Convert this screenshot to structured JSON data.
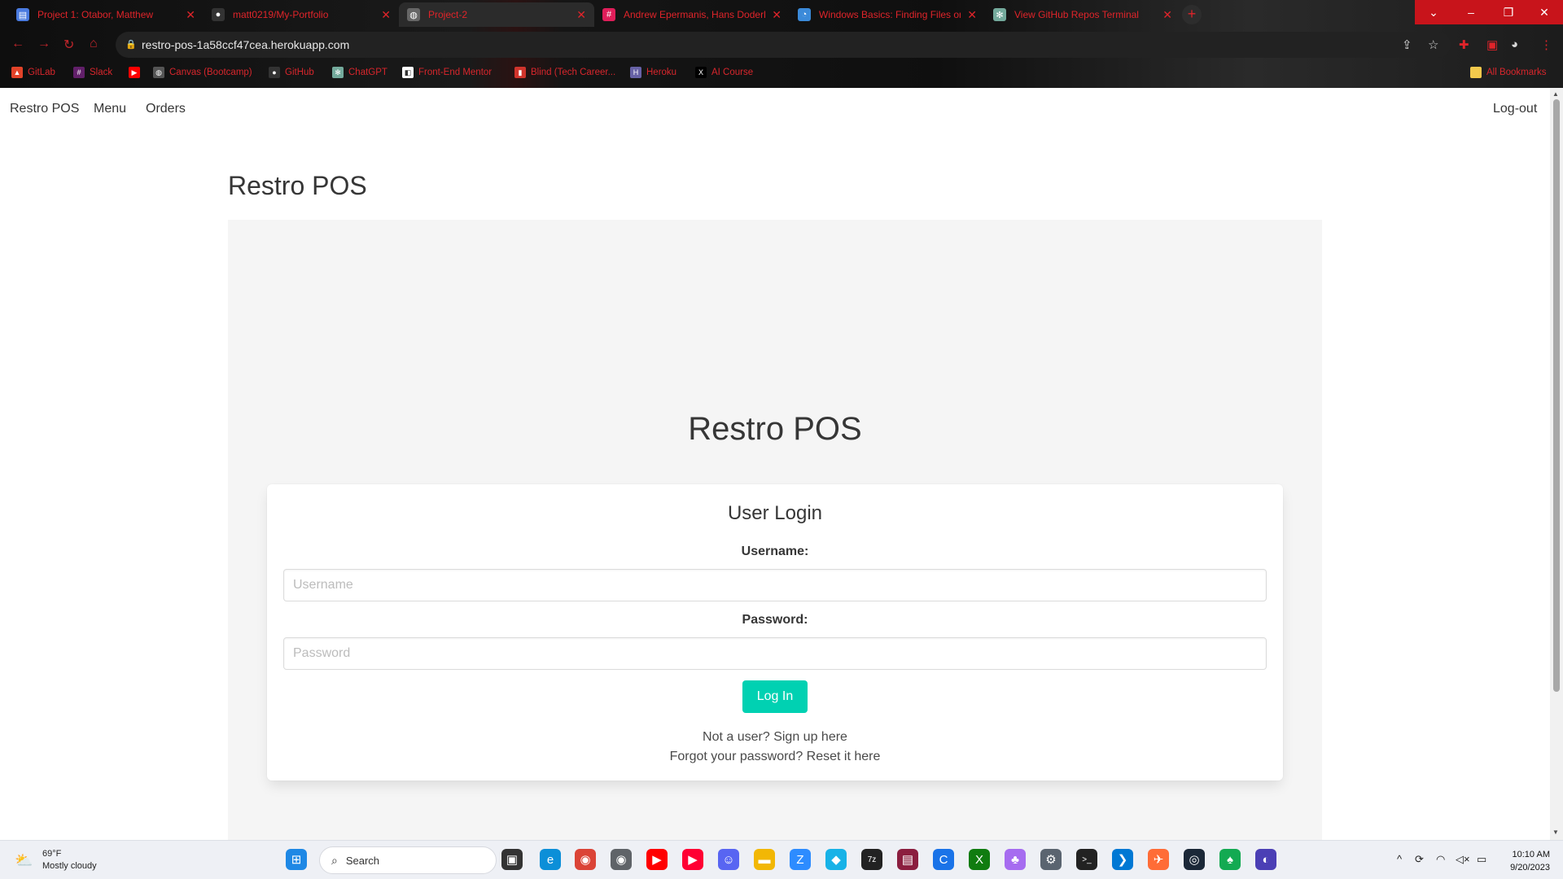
{
  "browser": {
    "tabs": [
      {
        "title": "Project 1: Otabor, Matthew",
        "icon": "doc-icon",
        "color": "#4a7be0"
      },
      {
        "title": "matt0219/My-Portfolio",
        "icon": "github-icon",
        "color": "#333333"
      },
      {
        "title": "Project-2",
        "icon": "globe-icon",
        "color": "#666666"
      },
      {
        "title": "Andrew Epermanis, Hans Doderl",
        "icon": "slack-icon",
        "color": "#e01e5a"
      },
      {
        "title": "Windows Basics: Finding Files on",
        "icon": "edu-icon",
        "color": "#3b8ad9"
      },
      {
        "title": "View GitHub Repos Terminal",
        "icon": "chatgpt-icon",
        "color": "#74aa9c"
      }
    ],
    "new_tab_label": "+",
    "window_controls": {
      "dropdown": "⌄",
      "minimize": "–",
      "restore": "❐",
      "close": "✕"
    },
    "url": "restro-pos-1a58ccf47cea.herokuapp.com",
    "bookmarks": [
      {
        "label": "GitLab",
        "icon": "gitlab-icon",
        "color": "#e24329"
      },
      {
        "label": "Slack",
        "icon": "slack-icon",
        "color": "#611f69"
      },
      {
        "label": "",
        "icon": "youtube-icon",
        "color": "#ff0000"
      },
      {
        "label": "Canvas (Bootcamp)",
        "icon": "globe-icon",
        "color": "#555555"
      },
      {
        "label": "GitHub",
        "icon": "github-icon",
        "color": "#333333"
      },
      {
        "label": "ChatGPT",
        "icon": "chatgpt-icon",
        "color": "#74aa9c"
      },
      {
        "label": "Front-End Mentor",
        "icon": "fem-icon",
        "color": "#ffffff"
      },
      {
        "label": "Blind (Tech Career...",
        "icon": "blind-icon",
        "color": "#d0342c"
      },
      {
        "label": "Heroku",
        "icon": "heroku-icon",
        "color": "#6762a6"
      },
      {
        "label": "AI Course",
        "icon": "x-icon",
        "color": "#000000"
      }
    ],
    "all_bookmarks": "All Bookmarks"
  },
  "nav": {
    "brand": "Restro POS",
    "menu": "Menu",
    "orders": "Orders",
    "logout": "Log-out"
  },
  "page": {
    "header_title": "Restro POS",
    "panel_title": "Restro POS"
  },
  "login": {
    "title": "User Login",
    "username_label": "Username:",
    "username_placeholder": "Username",
    "username_value": "",
    "password_label": "Password:",
    "password_placeholder": "Password",
    "password_value": "",
    "submit": "Log In",
    "signup_text": "Not a user? Sign up here",
    "reset_text": "Forgot your password? Reset it here",
    "accent": "#00d1b2"
  },
  "taskbar": {
    "weather_temp": "69°F",
    "weather_desc": "Mostly cloudy",
    "search_label": "Search",
    "time": "10:10 AM",
    "date": "9/20/2023",
    "apps": [
      {
        "name": "start-icon",
        "color": "#1e88e5",
        "glyph": "⊞"
      },
      {
        "name": "task-view-icon",
        "color": "#333333",
        "glyph": "▣"
      },
      {
        "name": "edge-icon",
        "color": "#0c8fd8",
        "glyph": "e"
      },
      {
        "name": "chrome-icon",
        "color": "#db4437",
        "glyph": "◉"
      },
      {
        "name": "chrome-dev-icon",
        "color": "#5f6368",
        "glyph": "◉"
      },
      {
        "name": "youtube-icon",
        "color": "#ff0000",
        "glyph": "▶"
      },
      {
        "name": "youtube-music-icon",
        "color": "#ff0033",
        "glyph": "▶"
      },
      {
        "name": "discord-icon",
        "color": "#5865f2",
        "glyph": "☺"
      },
      {
        "name": "file-explorer-icon",
        "color": "#f2b705",
        "glyph": "▬"
      },
      {
        "name": "zoom-icon",
        "color": "#2d8cff",
        "glyph": "Z"
      },
      {
        "name": "kodi-icon",
        "color": "#17b2e7",
        "glyph": "◆"
      },
      {
        "name": "7zip-icon",
        "color": "#222222",
        "glyph": "7z"
      },
      {
        "name": "winrar-icon",
        "color": "#8b1e3f",
        "glyph": "▤"
      },
      {
        "name": "ccleaner-icon",
        "color": "#1a73e8",
        "glyph": "C"
      },
      {
        "name": "xbox-icon",
        "color": "#107c10",
        "glyph": "X"
      },
      {
        "name": "game-controller-icon",
        "color": "#a66cf0",
        "glyph": "♣"
      },
      {
        "name": "settings-icon",
        "color": "#5a6470",
        "glyph": "⚙"
      },
      {
        "name": "terminal-icon",
        "color": "#222222",
        "glyph": ">_"
      },
      {
        "name": "vscode-icon",
        "color": "#0078d4",
        "glyph": "❯"
      },
      {
        "name": "postman-icon",
        "color": "#ff6c37",
        "glyph": "✈"
      },
      {
        "name": "steam-icon",
        "color": "#1b2838",
        "glyph": "◎"
      },
      {
        "name": "mongodb-icon",
        "color": "#13aa52",
        "glyph": "♠"
      },
      {
        "name": "app-icon",
        "color": "#4b3fb5",
        "glyph": "◐"
      }
    ]
  }
}
